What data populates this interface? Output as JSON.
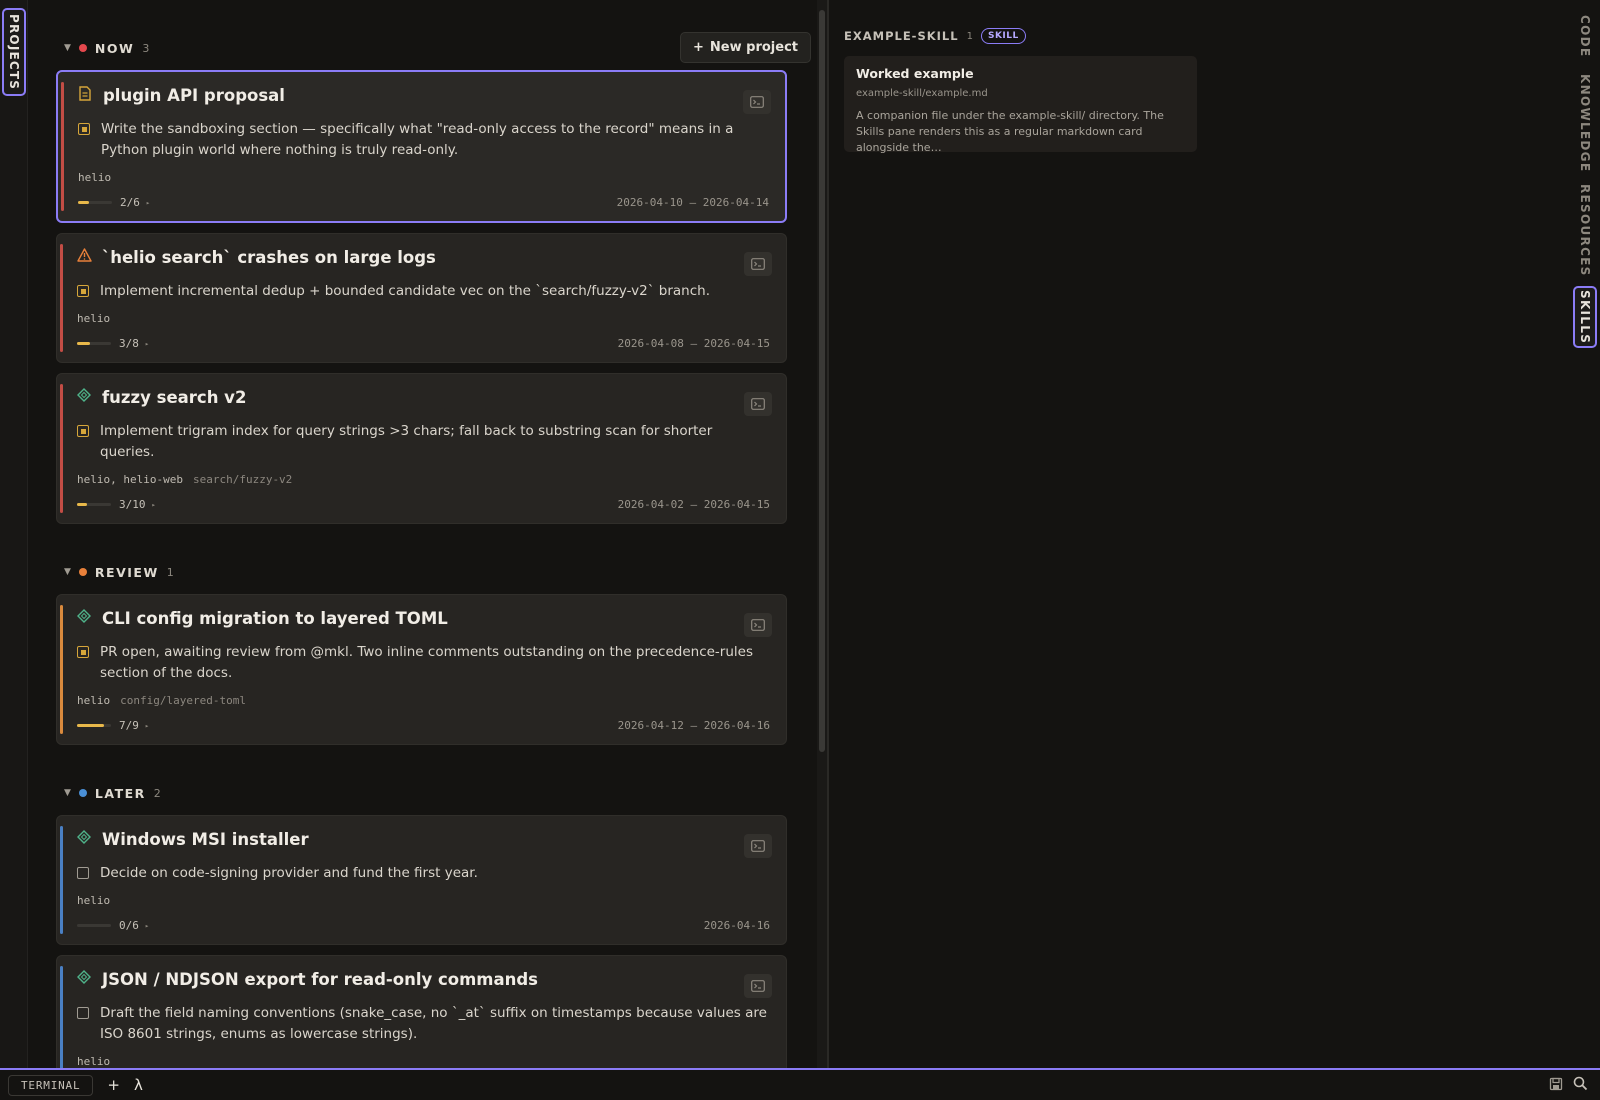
{
  "left_rail": {
    "projects_label": "PROJECTS"
  },
  "toolbar": {
    "new_project_label": "New project",
    "new_project_icon": "+"
  },
  "sections": [
    {
      "title": "NOW",
      "count": "3",
      "color": "#e5484d",
      "cards": [
        {
          "icon": "document-icon",
          "title": "plugin API proposal",
          "task": "Write the sandboxing section — specifically what \"read-only access to the record\" means in a Python plugin world where nothing is truly read-only.",
          "task_state": "active",
          "repos": "helio",
          "branch": "",
          "progress": "2/6",
          "progress_fraction": 0.33,
          "dates": "2026-04-10 — 2026-04-14",
          "accent": "#c24d45",
          "selected": true
        },
        {
          "icon": "warning-icon",
          "title": "`helio search` crashes on large logs",
          "task": "Implement incremental dedup + bounded candidate vec on the `search/fuzzy-v2` branch.",
          "task_state": "active",
          "repos": "helio",
          "branch": "",
          "progress": "3/8",
          "progress_fraction": 0.375,
          "dates": "2026-04-08 — 2026-04-15",
          "accent": "#c24d45",
          "selected": false
        },
        {
          "icon": "diamond-icon",
          "title": "fuzzy search v2",
          "task": "Implement trigram index for query strings >3 chars; fall back to substring scan for shorter queries.",
          "task_state": "active",
          "repos": "helio, helio-web",
          "branch": "search/fuzzy-v2",
          "progress": "3/10",
          "progress_fraction": 0.3,
          "dates": "2026-04-02 — 2026-04-15",
          "accent": "#c24d45",
          "selected": false
        }
      ]
    },
    {
      "title": "REVIEW",
      "count": "1",
      "color": "#e8803a",
      "cards": [
        {
          "icon": "diamond-icon",
          "title": "CLI config migration to layered TOML",
          "task": "PR open, awaiting review from @mkl. Two inline comments outstanding on the precedence-rules section of the docs.",
          "task_state": "active",
          "repos": "helio",
          "branch": "config/layered-toml",
          "progress": "7/9",
          "progress_fraction": 0.78,
          "dates": "2026-04-12 — 2026-04-16",
          "accent": "#d98a3d",
          "selected": false
        }
      ]
    },
    {
      "title": "LATER",
      "count": "2",
      "color": "#4a8fd6",
      "cards": [
        {
          "icon": "diamond-icon",
          "title": "Windows MSI installer",
          "task": "Decide on code-signing provider and fund the first year.",
          "task_state": "empty",
          "repos": "helio",
          "branch": "",
          "progress": "0/6",
          "progress_fraction": 0,
          "dates": "2026-04-16",
          "accent": "#4a80c4",
          "selected": false
        },
        {
          "icon": "diamond-icon",
          "title": "JSON / NDJSON export for read-only commands",
          "task": "Draft the field naming conventions (snake_case, no `_at` suffix on timestamps because values are ISO 8601 strings, enums as lowercase strings).",
          "task_state": "empty",
          "repos": "helio",
          "branch": "",
          "progress": "",
          "progress_fraction": 0,
          "dates": "",
          "accent": "#4a80c4",
          "selected": false
        }
      ]
    }
  ],
  "skills": {
    "name": "EXAMPLE-SKILL",
    "count": "1",
    "badge": "SKILL",
    "card": {
      "title": "Worked example",
      "path": "example-skill/example.md",
      "description": "A companion file under the example-skill/ directory. The Skills pane renders this as a regular markdown card alongside the…"
    }
  },
  "right_rail": {
    "tabs": [
      {
        "label": "CODE",
        "active": false
      },
      {
        "label": "KNOWLEDGE",
        "active": false
      },
      {
        "label": "RESOURCES",
        "active": false
      },
      {
        "label": "SKILLS",
        "active": true
      }
    ]
  },
  "bottom_bar": {
    "terminal_label": "TERMINAL",
    "add_label": "+",
    "lambda_label": "λ"
  },
  "colors": {
    "accent": "#8b7cf6",
    "progress": "#e8b84a",
    "checkbox": "#d6a63a"
  }
}
